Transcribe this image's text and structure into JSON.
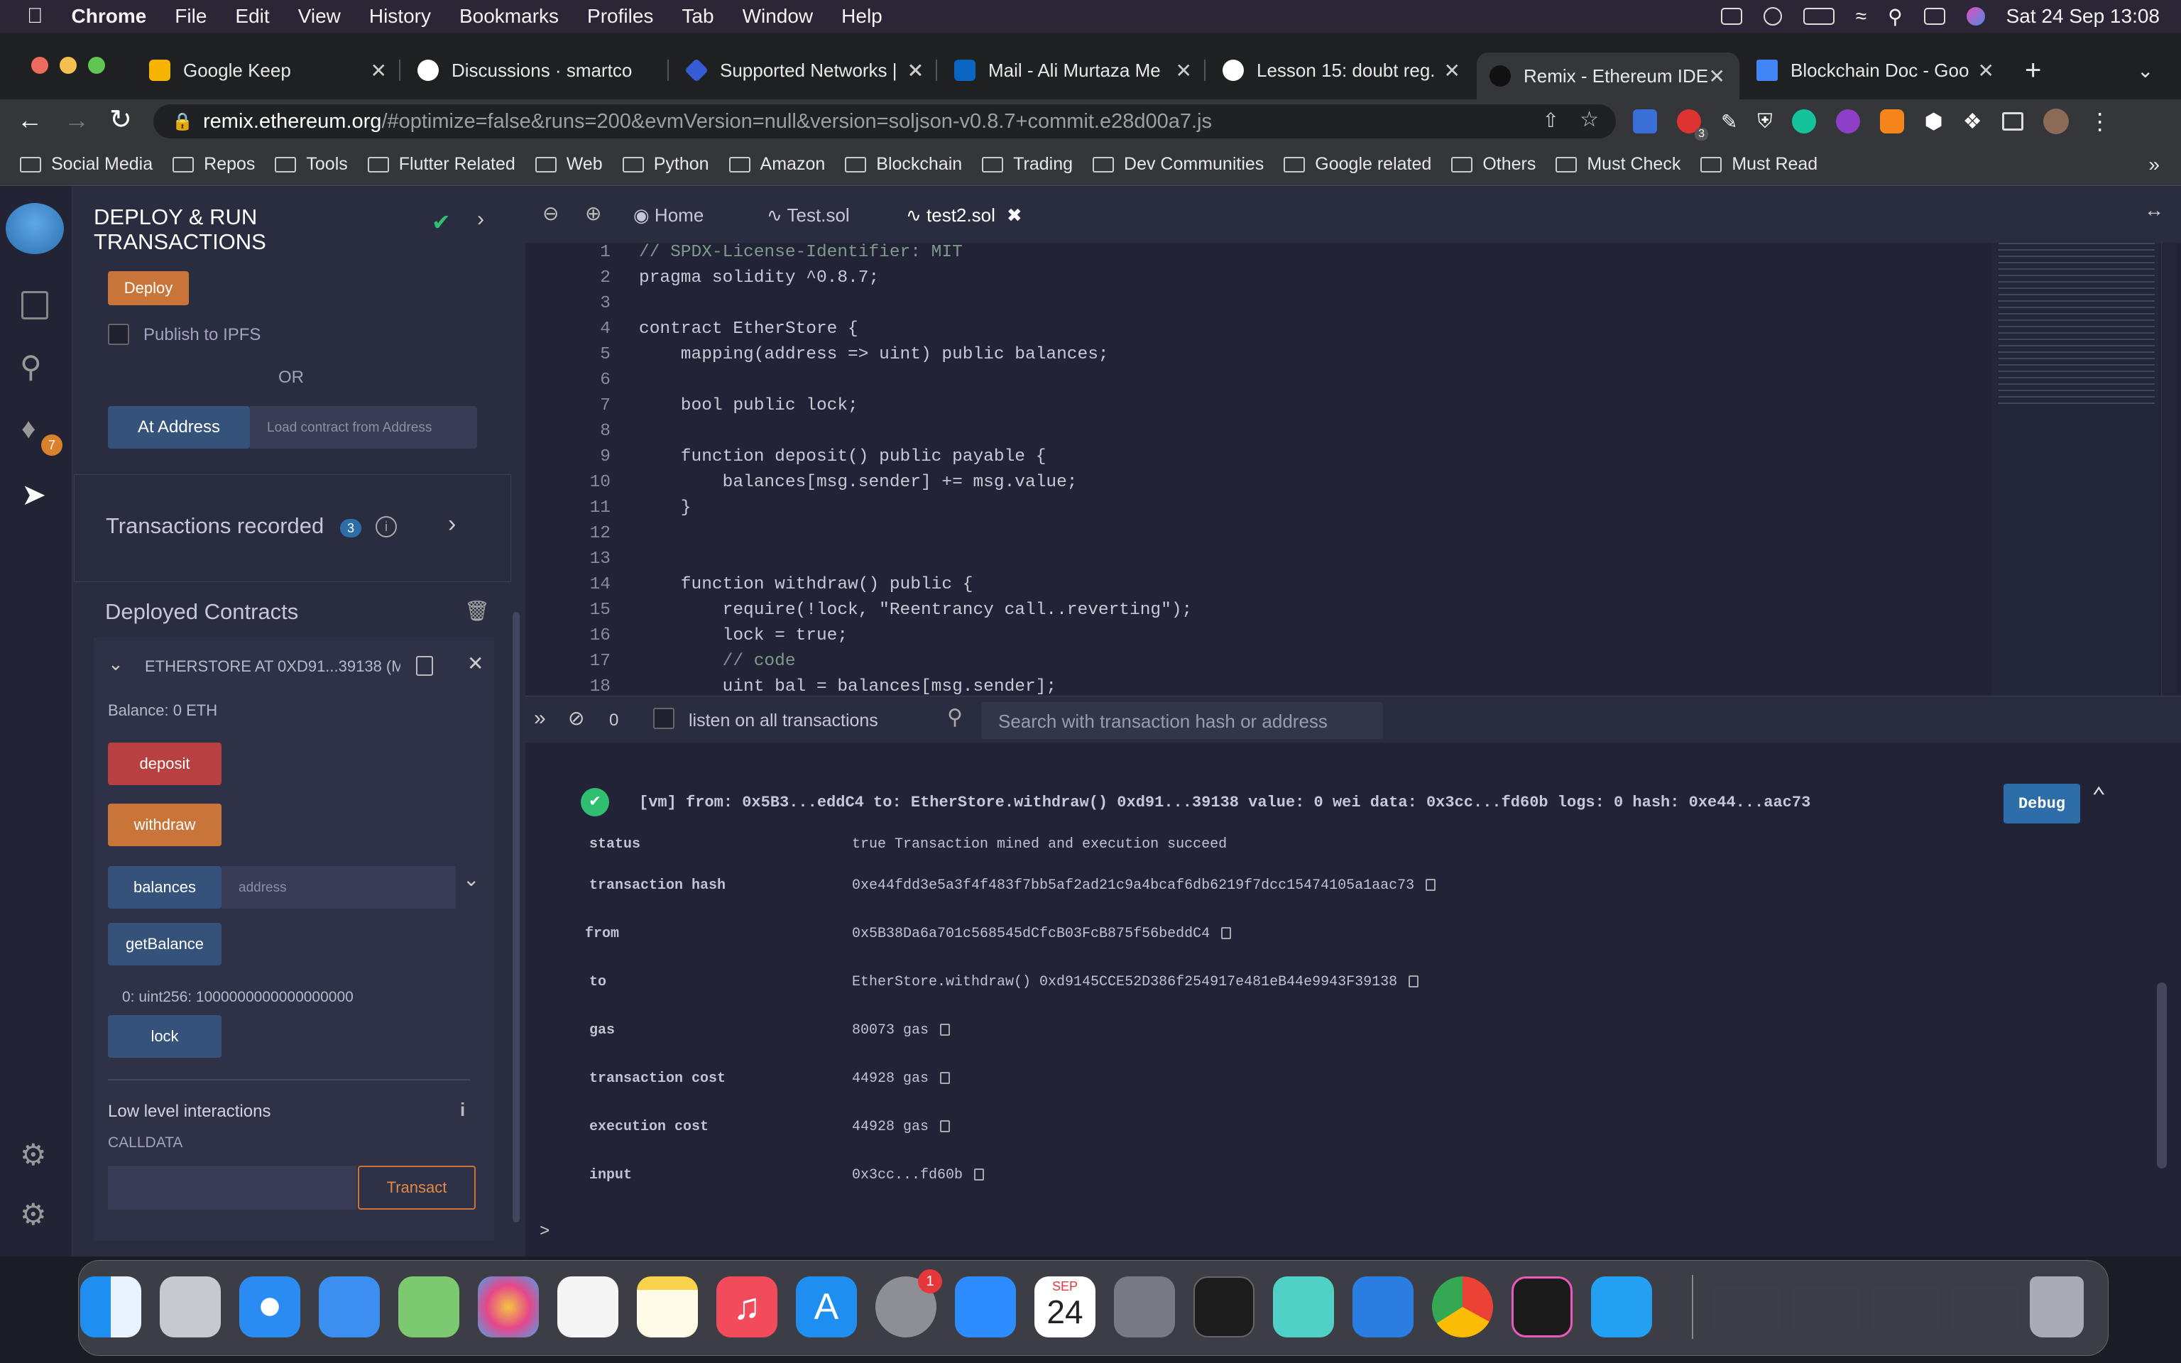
{
  "menubar": {
    "app": "Chrome",
    "items": [
      "File",
      "Edit",
      "View",
      "History",
      "Bookmarks",
      "Profiles",
      "Tab",
      "Window",
      "Help"
    ],
    "datetime": "Sat 24 Sep  13:08"
  },
  "tabs": [
    {
      "title": "Google Keep",
      "color": "#f6b400"
    },
    {
      "title": "Discussions · smartco",
      "color": "#ffffff"
    },
    {
      "title": "Supported Networks |",
      "color": "#375bd2"
    },
    {
      "title": "Mail - Ali Murtaza Me",
      "color": "#0a64c2"
    },
    {
      "title": "Lesson 15: doubt reg.",
      "color": "#ffffff"
    },
    {
      "title": "Remix - Ethereum IDE",
      "color": "#2b2b2b"
    },
    {
      "title": "Blockchain Doc - Goo",
      "color": "#4285f4"
    }
  ],
  "url": {
    "host": "remix.ethereum.org",
    "path": "/#optimize=false&runs=200&evmVersion=null&version=soljson-v0.8.7+commit.e28d00a7.js"
  },
  "ext_badge": "3",
  "bookmarks": [
    "Social Media",
    "Repos",
    "Tools",
    "Flutter Related",
    "Web",
    "Python",
    "Amazon",
    "Blockchain",
    "Trading",
    "Dev Communities",
    "Google related",
    "Others",
    "Must Check",
    "Must Read"
  ],
  "rail": {
    "badge": "7"
  },
  "panel": {
    "title1": "DEPLOY & RUN",
    "title2": "TRANSACTIONS",
    "deploy": "Deploy",
    "publish": "Publish to IPFS",
    "or": "OR",
    "at_address": "At Address",
    "load_placeholder": "Load contract from Address",
    "tx_recorded": "Transactions recorded",
    "tx_count": "3",
    "deployed": "Deployed Contracts",
    "contract": "ETHERSTORE AT 0XD91...39138 (M",
    "balance": "Balance: 0 ETH",
    "fn_deposit": "deposit",
    "fn_withdraw": "withdraw",
    "fn_balances": "balances",
    "address_placeholder": "address",
    "fn_getBalance": "getBalance",
    "result": "0: uint256: 1000000000000000000",
    "fn_lock": "lock",
    "low_level": "Low level interactions",
    "calldata": "CALLDATA",
    "transact": "Transact"
  },
  "editor": {
    "tabs": [
      "Home",
      "Test.sol",
      "test2.sol"
    ],
    "lines": [
      {
        "n": "1",
        "t": "// SPDX-License-Identifier: MIT"
      },
      {
        "n": "2",
        "t": "pragma solidity ^0.8.7;"
      },
      {
        "n": "3",
        "t": ""
      },
      {
        "n": "4",
        "t": "contract EtherStore {"
      },
      {
        "n": "5",
        "t": "    mapping(address => uint) public balances;"
      },
      {
        "n": "6",
        "t": ""
      },
      {
        "n": "7",
        "t": "    bool public lock;"
      },
      {
        "n": "8",
        "t": ""
      },
      {
        "n": "9",
        "t": "    function deposit() public payable {"
      },
      {
        "n": "10",
        "t": "        balances[msg.sender] += msg.value;"
      },
      {
        "n": "11",
        "t": "    }"
      },
      {
        "n": "12",
        "t": ""
      },
      {
        "n": "13",
        "t": ""
      },
      {
        "n": "14",
        "t": "    function withdraw() public {"
      },
      {
        "n": "15",
        "t": "        require(!lock, \"Reentrancy call..reverting\");"
      },
      {
        "n": "16",
        "t": "        lock = true;"
      },
      {
        "n": "17",
        "t": "        // code"
      },
      {
        "n": "18",
        "t": "        uint bal = balances[msg.sender];"
      }
    ]
  },
  "terminal": {
    "count": "0",
    "listen": "listen on all transactions",
    "search_placeholder": "Search with transaction hash or address",
    "summary": "[vm] from: 0x5B3...eddC4 to: EtherStore.withdraw() 0xd91...39138 value: 0 wei data: 0x3cc...fd60b logs: 0 hash: 0xe44...aac73",
    "debug": "Debug",
    "rows": [
      {
        "k": "status",
        "v": "true Transaction mined and execution succeed"
      },
      {
        "k": "transaction hash",
        "v": "0xe44fdd3e5a3f4f483f7bb5af2ad21c9a4bcaf6db6219f7dcc15474105a1aac73"
      },
      {
        "k": "from",
        "v": "0x5B38Da6a701c568545dCfcB03FcB875f56beddC4"
      },
      {
        "k": "to",
        "v": "EtherStore.withdraw() 0xd9145CCE52D386f254917e481eB44e9943F39138"
      },
      {
        "k": "gas",
        "v": "80073 gas"
      },
      {
        "k": "transaction cost",
        "v": "44928 gas"
      },
      {
        "k": "execution cost",
        "v": "44928 gas"
      },
      {
        "k": "input",
        "v": "0x3cc...fd60b"
      }
    ],
    "prompt": ">"
  },
  "dock": {
    "calendar_month": "SEP",
    "calendar_day": "24",
    "settings_badge": "1"
  }
}
